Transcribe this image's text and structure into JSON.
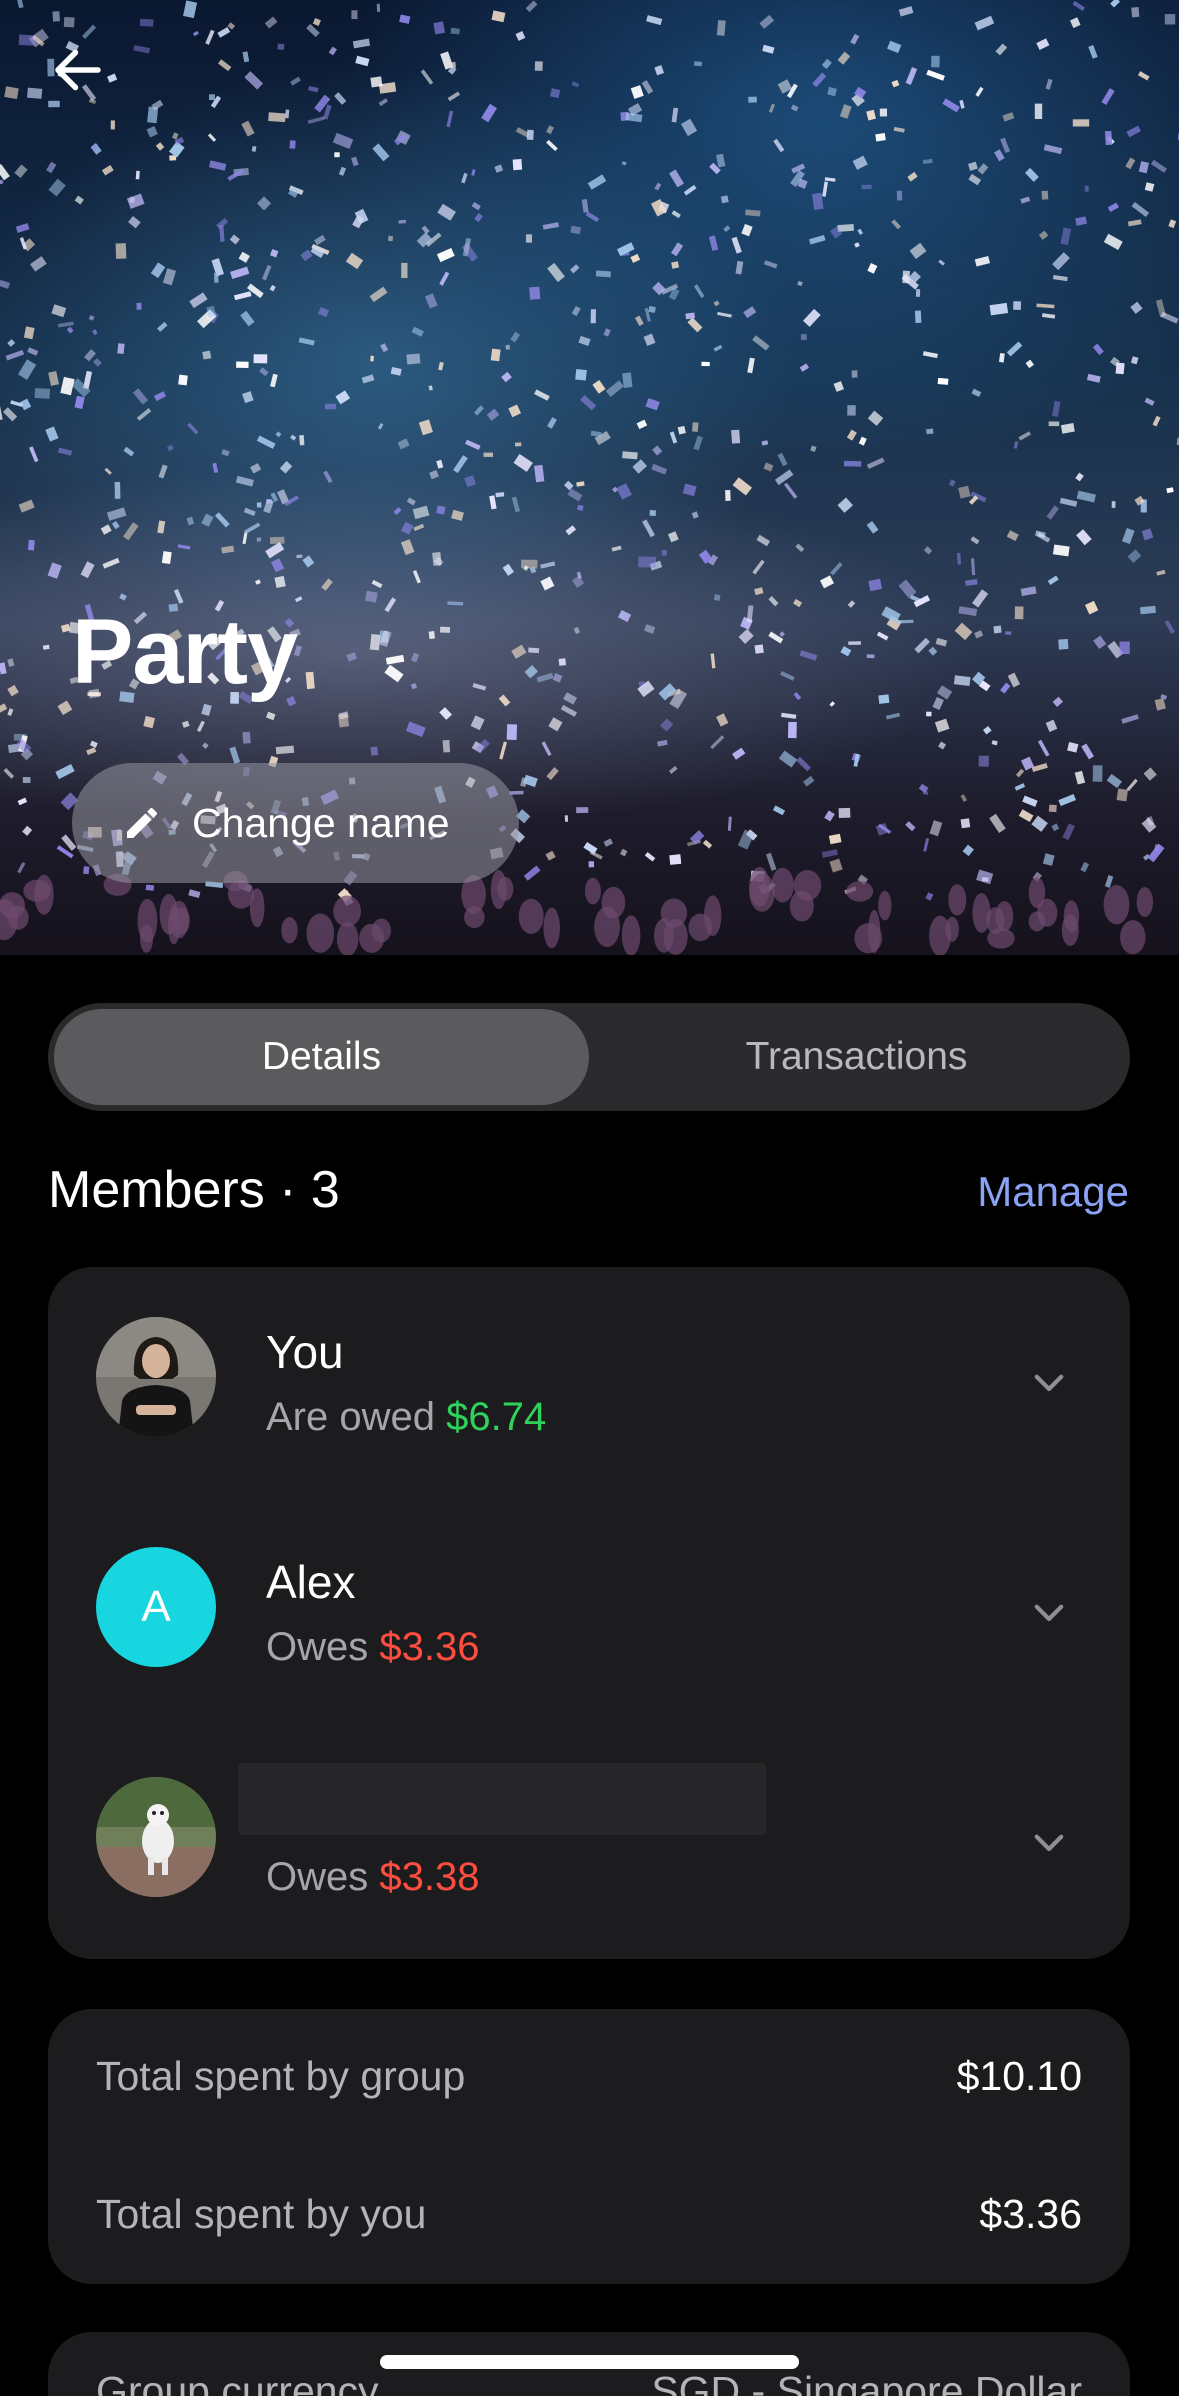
{
  "header": {
    "back_icon": "arrow-left-icon",
    "group_name": "Party",
    "change_name_label": "Change name",
    "change_name_icon": "pencil-icon"
  },
  "tabs": [
    {
      "label": "Details",
      "active": true
    },
    {
      "label": "Transactions",
      "active": false
    }
  ],
  "members": {
    "title": "Members · 3",
    "manage_label": "Manage",
    "list": [
      {
        "name": "You",
        "status_prefix": "Are owed",
        "amount": "$6.74",
        "amount_color": "#2fd35c",
        "avatar": "photo"
      },
      {
        "name": "Alex",
        "status_prefix": "Owes",
        "amount": "$3.36",
        "amount_color": "#ff4d40",
        "avatar_letter": "A",
        "avatar_color": "#17d6e0"
      },
      {
        "name": "",
        "status_prefix": "Owes",
        "amount": "$3.38",
        "amount_color": "#ff4d40",
        "avatar": "photo",
        "name_redacted": true
      }
    ]
  },
  "totals": {
    "group_label": "Total spent by group",
    "group_value": "$10.10",
    "you_label": "Total spent by you",
    "you_value": "$3.36"
  },
  "currency": {
    "label": "Group currency",
    "value": "SGD - Singapore Dollar"
  },
  "colors": {
    "accent_link": "#8aa3f5",
    "positive": "#2fd35c",
    "negative": "#ff4d40",
    "card_bg": "#1c1c1e"
  }
}
